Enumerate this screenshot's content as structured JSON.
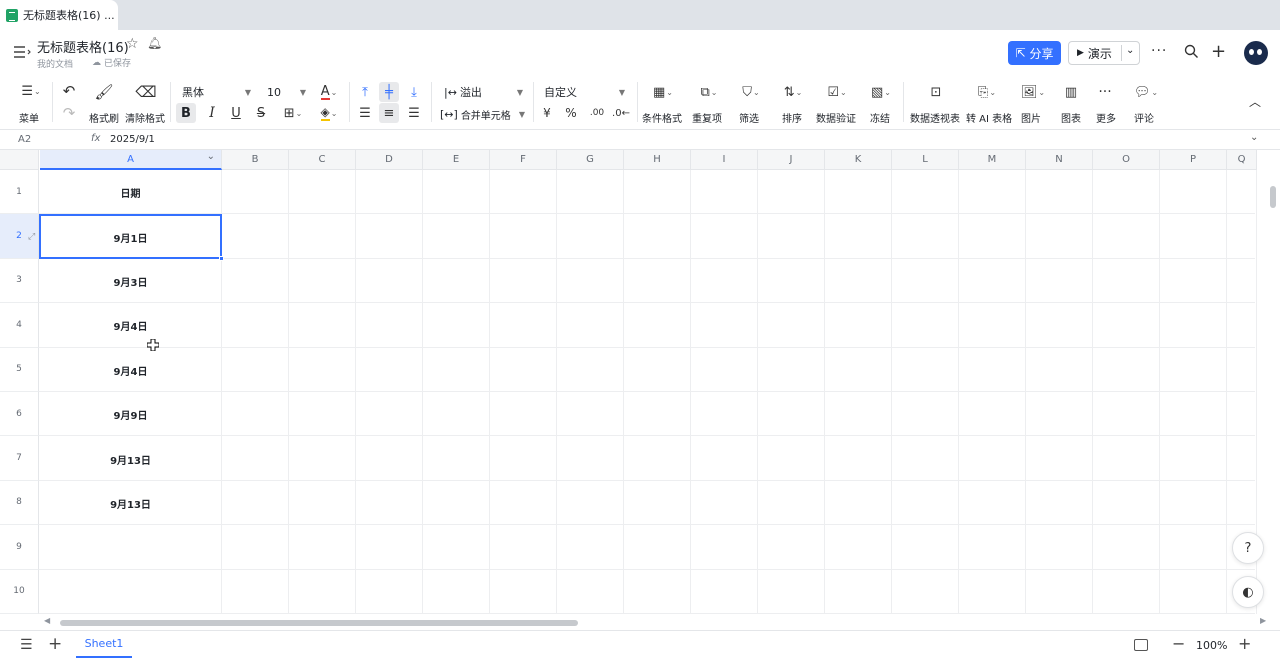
{
  "browser": {
    "tab_title": "无标题表格(16) ..."
  },
  "titlebar": {
    "doc_title": "无标题表格(16)",
    "location": "我的文档",
    "saved_status": "已保存",
    "share_label": "分享",
    "present_label": "演示",
    "accent_color": "#3370ff"
  },
  "toolbar": {
    "menu_label": "菜单",
    "format_painter_label": "格式刷",
    "clear_format_label": "清除格式",
    "font_family": "黑体",
    "font_size": "10",
    "overflow_label": "溢出",
    "merge_label": "合并单元格",
    "number_format": "自定义",
    "currency_symbol": "¥",
    "percent_symbol": "%",
    "decimal_label": ".00",
    "conditional_format_label": "条件格式",
    "duplicates_label": "重复项",
    "filter_label": "筛选",
    "sort_label": "排序",
    "data_validation_label": "数据验证",
    "freeze_label": "冻结",
    "pivot_label": "数据透视表",
    "to_ai_table_label": "转 AI 表格",
    "image_label": "图片",
    "chart_label": "图表",
    "more_label": "更多",
    "comment_label": "评论"
  },
  "formula_bar": {
    "cell_ref": "A2",
    "fx_label": "fx",
    "value": "2025/9/1"
  },
  "grid": {
    "columns": [
      "A",
      "B",
      "C",
      "D",
      "E",
      "F",
      "G",
      "H",
      "I",
      "J",
      "K",
      "L",
      "M",
      "N",
      "O",
      "P",
      "Q"
    ],
    "rows": [
      "1",
      "2",
      "3",
      "4",
      "5",
      "6",
      "7",
      "8",
      "9",
      "10"
    ],
    "cells": [
      "日期",
      "9月1日",
      "9月3日",
      "9月4日",
      "9月4日",
      "9月9日",
      "9月13日",
      "9月13日"
    ],
    "active_cell": "A2"
  },
  "sheetbar": {
    "sheet_name": "Sheet1",
    "zoom": "100%"
  }
}
